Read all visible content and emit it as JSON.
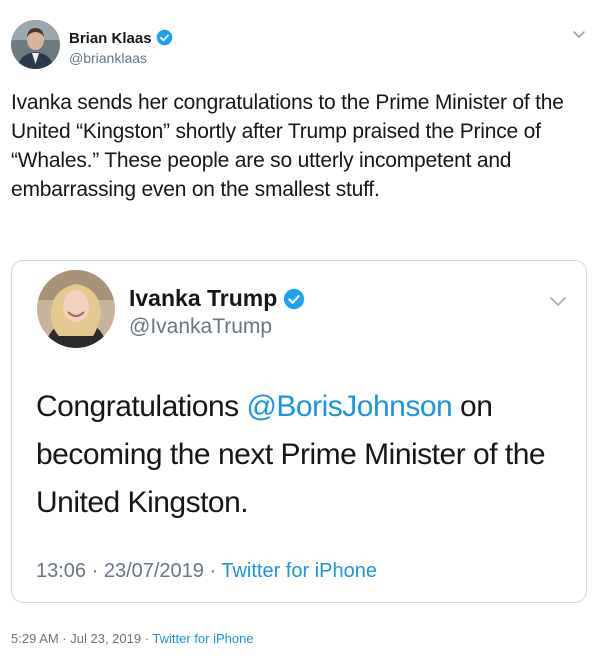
{
  "tweet": {
    "author_name": "Brian Klaas",
    "author_handle": "@brianklaas",
    "text": "Ivanka sends her congratulations to the Prime Minister of the United “Kingston” shortly after Trump praised the Prince of “Whales.” These people are so utterly incompetent and embarrassing even on the smallest stuff.",
    "timestamp": "5:29 AM · Jul 23, 2019",
    "separator": " · ",
    "source": "Twitter for iPhone"
  },
  "embedded_tweet": {
    "author_name": "Ivanka Trump",
    "author_handle": "@IvankaTrump",
    "text_before": "Congratulations ",
    "mention": "@BorisJohnson",
    "text_after": " on becoming the next Prime Minister of the United Kingston.",
    "timestamp": "13:06 · 23/07/2019",
    "separator": " · ",
    "source": "Twitter for iPhone"
  },
  "colors": {
    "accent": "#1b95e0",
    "verified": "#1da1f2",
    "muted": "#657786",
    "text": "#14171a",
    "border": "#cfd9de"
  },
  "icons": [
    "verified-badge-icon",
    "chevron-down-icon"
  ]
}
